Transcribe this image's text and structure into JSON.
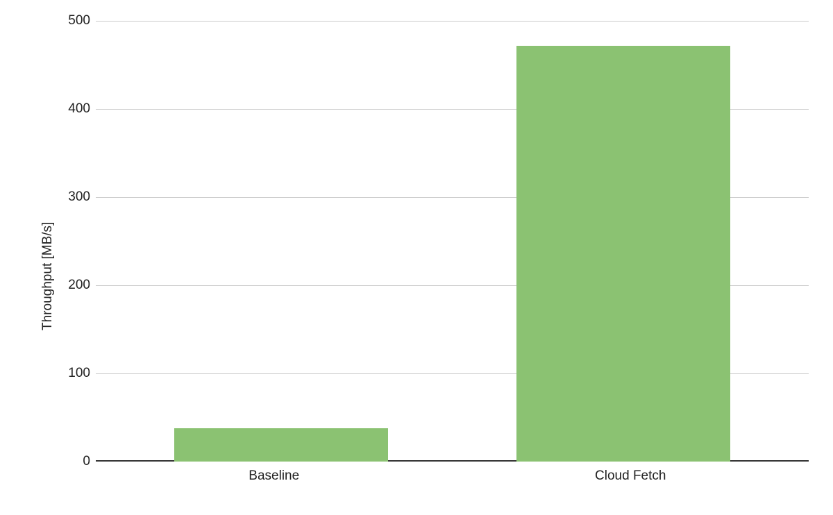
{
  "chart_data": {
    "type": "bar",
    "categories": [
      "Baseline",
      "Cloud Fetch"
    ],
    "values": [
      38,
      472
    ],
    "title": "",
    "xlabel": "",
    "ylabel": "Throughput [MB/s]",
    "ylim": [
      0,
      500
    ],
    "yticks": [
      0,
      100,
      200,
      300,
      400,
      500
    ],
    "bar_color": "#8bc272"
  }
}
